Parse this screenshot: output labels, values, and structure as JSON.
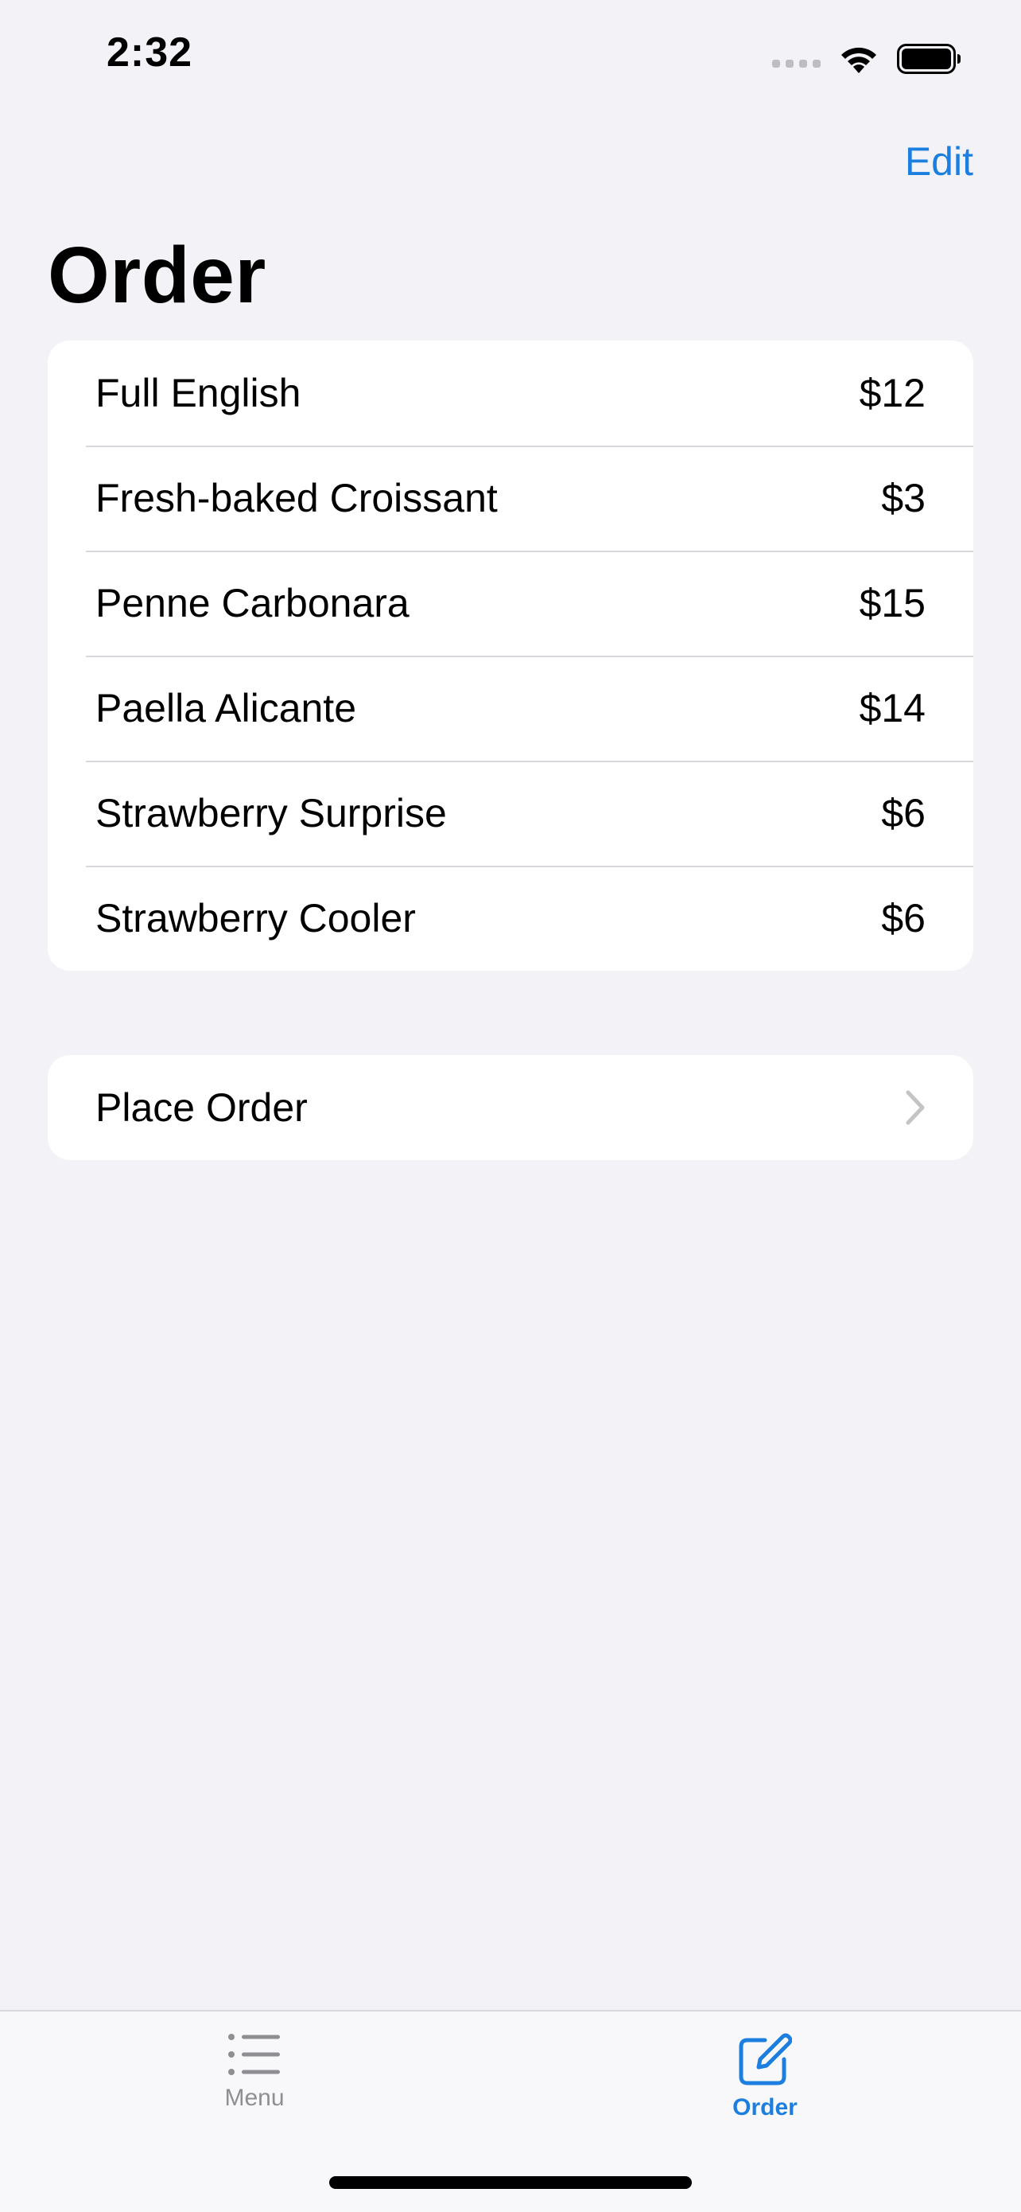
{
  "status_bar": {
    "time": "2:32"
  },
  "nav": {
    "edit_label": "Edit",
    "title": "Order"
  },
  "order_items": [
    {
      "name": "Full English",
      "price": "$12"
    },
    {
      "name": "Fresh-baked Croissant",
      "price": "$3"
    },
    {
      "name": "Penne Carbonara",
      "price": "$15"
    },
    {
      "name": "Paella Alicante",
      "price": "$14"
    },
    {
      "name": "Strawberry Surprise",
      "price": "$6"
    },
    {
      "name": "Strawberry Cooler",
      "price": "$6"
    }
  ],
  "place_order": {
    "label": "Place Order",
    "icon": "chevron-right-icon"
  },
  "tab_bar": {
    "tabs": [
      {
        "label": "Menu",
        "icon": "list-icon",
        "selected": false
      },
      {
        "label": "Order",
        "icon": "compose-icon",
        "selected": true
      }
    ]
  },
  "colors": {
    "accent": "#1C7FE0",
    "background": "#F2F2F7",
    "inactive_tab": "#8E8E93"
  }
}
